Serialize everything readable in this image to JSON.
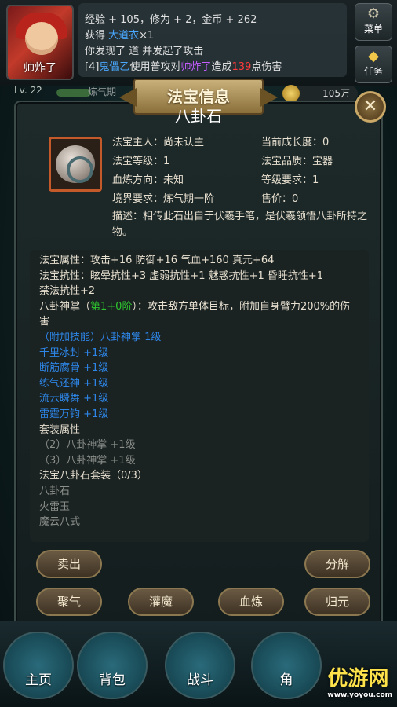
{
  "player": {
    "name": "帅炸了",
    "level": "Lv. 22",
    "cultivation": "炼气期",
    "gold": "105万"
  },
  "chat": {
    "line1": "经验 + 105，修为 + 2，金币 + 262",
    "line2_pre": "获得 ",
    "line2_item": "大道衣",
    "line2_post": "×1",
    "line3": "你发现了 道 并发起了攻击",
    "line4_pre": "[4]",
    "line4_actor": "鬼儡乙",
    "line4_mid": "使用普攻对",
    "line4_target": "帅炸了",
    "line4_mid2": "造成",
    "line4_dmg": "139",
    "line4_post": "点伤害"
  },
  "side": {
    "menu": "菜单",
    "task": "任务"
  },
  "panel": {
    "banner": "法宝信息",
    "title": "八卦石",
    "owner": "法宝主人：尚未认主",
    "growth": "当前成长度：0",
    "level": "法宝等级：1",
    "quality": "法宝品质：宝器",
    "refine": "血炼方向：未知",
    "req_level": "等级要求：1",
    "realm": "境界要求：炼气期一阶",
    "price": "售价：0",
    "desc": "描述：相传此石出自于伏羲手笔，是伏羲领悟八卦所持之物。"
  },
  "attrs": {
    "a1": "法宝属性：攻击+16 防御+16 气血+160 真元+64",
    "a2": "法宝抗性：眩晕抗性+3 虚弱抗性+1 魅惑抗性+1 昏睡抗性+1",
    "a3": "禁法抗性+2",
    "skill_pre": "八卦神掌（",
    "skill_lvl": "第1+0阶",
    "skill_post": "）：攻击敌方单体目标，附加自身臂力200%的伤害",
    "add1": "（附加技能）八卦神掌 1级",
    "add2": "千里冰封 +1级",
    "add3": "断筋腐骨 +1级",
    "add4": "练气还神 +1级",
    "add5": "流云瞬舞 +1级",
    "add6": "雷霆万钧 +1级",
    "set_head": "套装属性",
    "set1": "（2）八卦神掌 +1级",
    "set2": "（3）八卦神掌 +1级",
    "suit": "法宝八卦石套装（0/3）",
    "p1": "八卦石",
    "p2": "火雷玉",
    "p3": "魔云八式"
  },
  "buttons": {
    "sell": "卖出",
    "split": "分解",
    "gather": "聚气",
    "infuse": "灌魔",
    "blood": "血炼",
    "return": "归元"
  },
  "nav": {
    "home": "主页",
    "bag": "背包",
    "battle": "战斗",
    "n4": "角"
  },
  "watermark": {
    "brand": "优游网",
    "url": "www.yoyou.com"
  }
}
